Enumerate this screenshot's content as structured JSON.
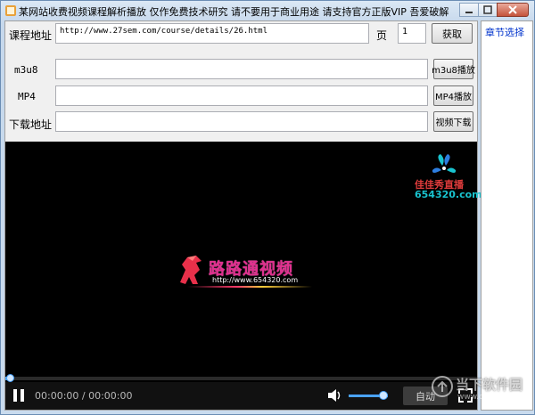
{
  "window": {
    "title": "某网站收费视频课程解析播放 仅作免费技术研究 请不要用于商业用途 请支持官方正版VIP 吾爱破解"
  },
  "form": {
    "course_label": "课程地址",
    "course_url": "http://www.27sem.com/course/details/26.html",
    "page_label": "页",
    "page_value": "1",
    "fetch_button": "获取",
    "m3u8_label": "m3u8",
    "m3u8_value": "",
    "m3u8_play_button": "m3u8播放",
    "mp4_label": "MP4",
    "mp4_value": "",
    "mp4_play_button": "MP4播放",
    "download_label": "下载地址",
    "download_value": "",
    "video_download_button": "视频下载"
  },
  "side": {
    "title": "章节选择"
  },
  "player": {
    "corner_logo_name": "佳佳秀直播",
    "corner_logo_number": "654320.com",
    "brand_name": "路路通视频",
    "brand_url": "http://www.654320.com",
    "time_display": "00:00:00 / 00:00:00",
    "quality_label": "自动",
    "progress": 0.0,
    "volume": 0.8
  },
  "watermark": {
    "text": "当下软件园",
    "url": "www.downxia.com"
  },
  "colors": {
    "accent": "#4aa3ff",
    "brand_pink": "#e0308e",
    "side_title": "#0033cc"
  }
}
